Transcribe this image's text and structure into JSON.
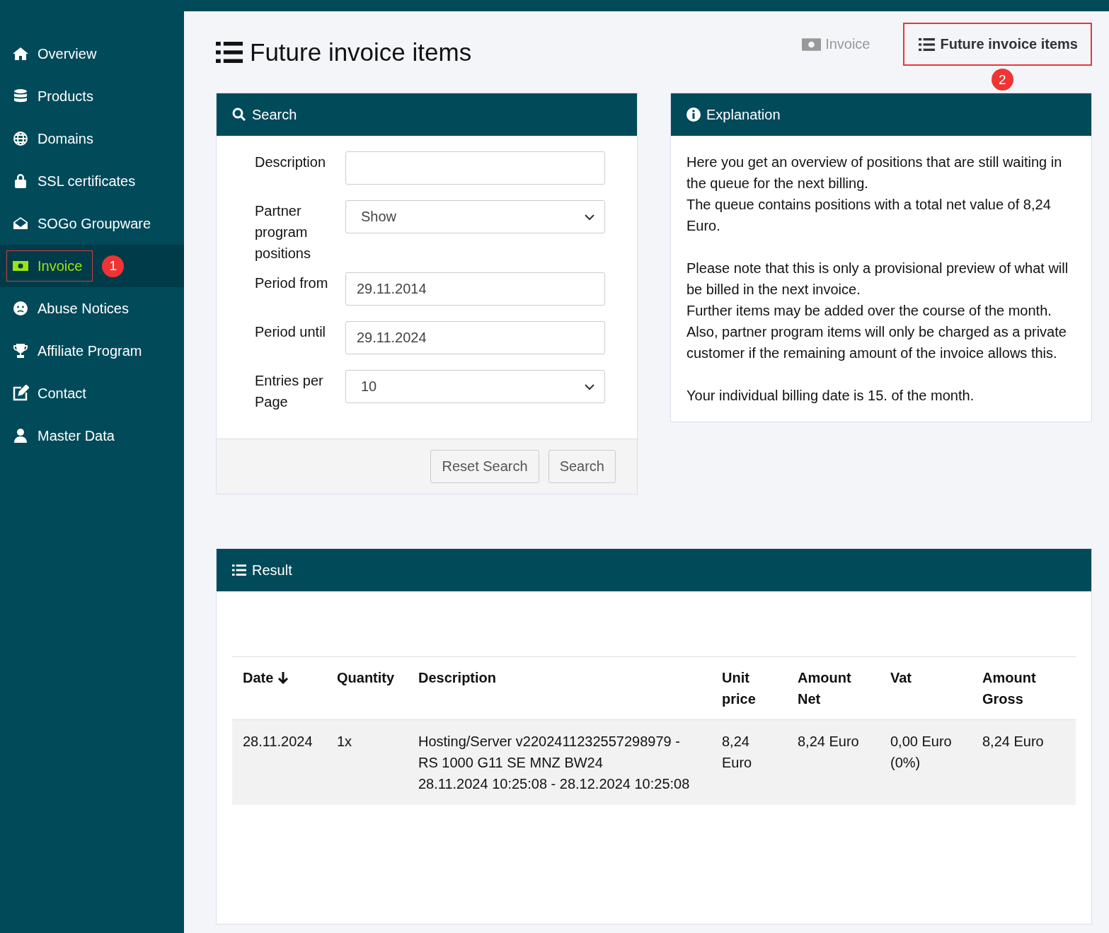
{
  "sidebar": {
    "items": [
      {
        "label": "Overview",
        "selected": false
      },
      {
        "label": "Products",
        "selected": false
      },
      {
        "label": "Domains",
        "selected": false
      },
      {
        "label": "SSL certificates",
        "selected": false
      },
      {
        "label": "SOGo Groupware",
        "selected": false
      },
      {
        "label": "Invoice",
        "selected": true,
        "annotation": "1"
      },
      {
        "label": "Abuse Notices",
        "selected": false
      },
      {
        "label": "Affiliate Program",
        "selected": false
      },
      {
        "label": "Contact",
        "selected": false
      },
      {
        "label": "Master Data",
        "selected": false
      }
    ]
  },
  "header": {
    "title": "Future invoice items",
    "tabs": [
      {
        "label": "Invoice",
        "selected": false
      },
      {
        "label": "Future invoice items",
        "selected": true,
        "annotation": "2"
      }
    ]
  },
  "search_panel": {
    "title": "Search",
    "fields": [
      {
        "kind": "text",
        "label": "Description"
      },
      {
        "kind": "select",
        "label": "Partner program positions",
        "value": "Show"
      },
      {
        "kind": "text",
        "label": "Period from",
        "value": "29.11.2014"
      },
      {
        "kind": "text",
        "label": "Period until",
        "value": "29.11.2024"
      },
      {
        "kind": "select",
        "label": "Entries per Page",
        "value": "10"
      }
    ],
    "buttons": [
      "Reset Search",
      "Search"
    ]
  },
  "explanation": {
    "title": "Explanation",
    "paragraphs": [
      [
        "Here you get an overview of positions that are still waiting in the queue for the next billing.",
        "The queue contains positions with a total net value of 8,24 Euro."
      ],
      [
        "Please note that this is only a provisional preview of what will be billed in the next invoice.",
        "Further items may be added over the course of the month.",
        "Also, partner program items will only be charged as a private customer if the remaining amount of the invoice allows this."
      ],
      [
        "Your individual billing date is 15. of the month."
      ]
    ]
  },
  "result": {
    "title": "Result",
    "columns": [
      {
        "label": "Date",
        "sorted": true
      },
      {
        "label": "Quantity",
        "sorted": false
      },
      {
        "label": "Description",
        "sorted": false
      },
      {
        "label": "Unit price",
        "sorted": false
      },
      {
        "label": "Amount Net",
        "sorted": false
      },
      {
        "label": "Vat",
        "sorted": false
      },
      {
        "label": "Amount Gross",
        "sorted": false
      }
    ],
    "rows": [
      {
        "cells": [
          "28.11.2024",
          "1x",
          [
            "Hosting/Server v2202411232557298979 - RS 1000 G11 SE MNZ BW24",
            "28.11.2024 10:25:08 - 28.12.2024 10:25:08"
          ],
          "8,24 Euro",
          "8,24 Euro",
          "0,00 Euro (0%)",
          "8,24 Euro"
        ]
      }
    ]
  }
}
